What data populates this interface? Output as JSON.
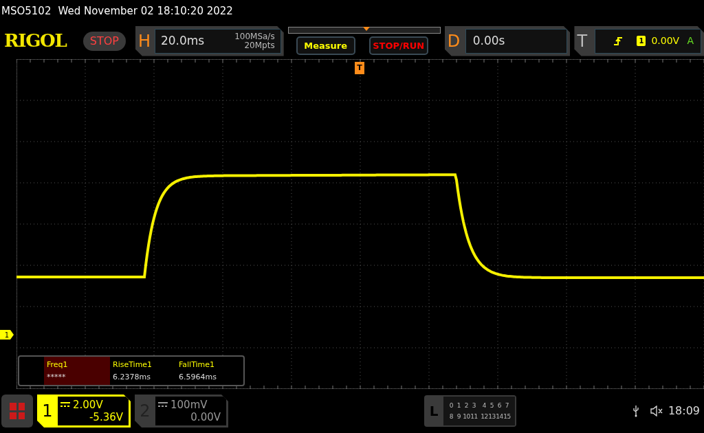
{
  "title_bar": {
    "model": "MSO5102",
    "datetime": "Wed November 02 18:10:20 2022"
  },
  "header": {
    "logo": "RIGOL",
    "run_state": "STOP",
    "horizontal": {
      "label": "H",
      "timebase": "20.0ms",
      "sample_rate": "100MSa/s",
      "memory": "20Mpts"
    },
    "buttons": [
      {
        "label": "Measure",
        "color": "#ffff00"
      },
      {
        "label": "STOP/RUN",
        "color": "#ff0000"
      }
    ],
    "delay": {
      "label": "D",
      "value": "0.00s"
    },
    "trigger": {
      "label": "T",
      "source": "1",
      "level": "0.00V",
      "mode": "A"
    }
  },
  "display": {
    "trigger_marker": "T",
    "channel_marker": "1",
    "measurements": [
      {
        "name": "Freq1",
        "value": "*****",
        "selected": true
      },
      {
        "name": "RiseTime1",
        "value": "6.2378ms",
        "selected": false
      },
      {
        "name": "FallTime1",
        "value": "6.5964ms",
        "selected": false
      }
    ]
  },
  "bottom_bar": {
    "channels": [
      {
        "number": "1",
        "scale": "2.00V",
        "offset": "-5.36V",
        "selected": true
      },
      {
        "number": "2",
        "scale": "100mV",
        "offset": "0.00V",
        "selected": false
      }
    ],
    "logic": {
      "label": "L",
      "rows": [
        [
          "0",
          "1",
          "2",
          "3",
          "4",
          "5",
          "6",
          "7"
        ],
        [
          "8",
          "9",
          "10",
          "11",
          "12",
          "13",
          "14",
          "15"
        ]
      ]
    },
    "time": "18:09"
  }
}
